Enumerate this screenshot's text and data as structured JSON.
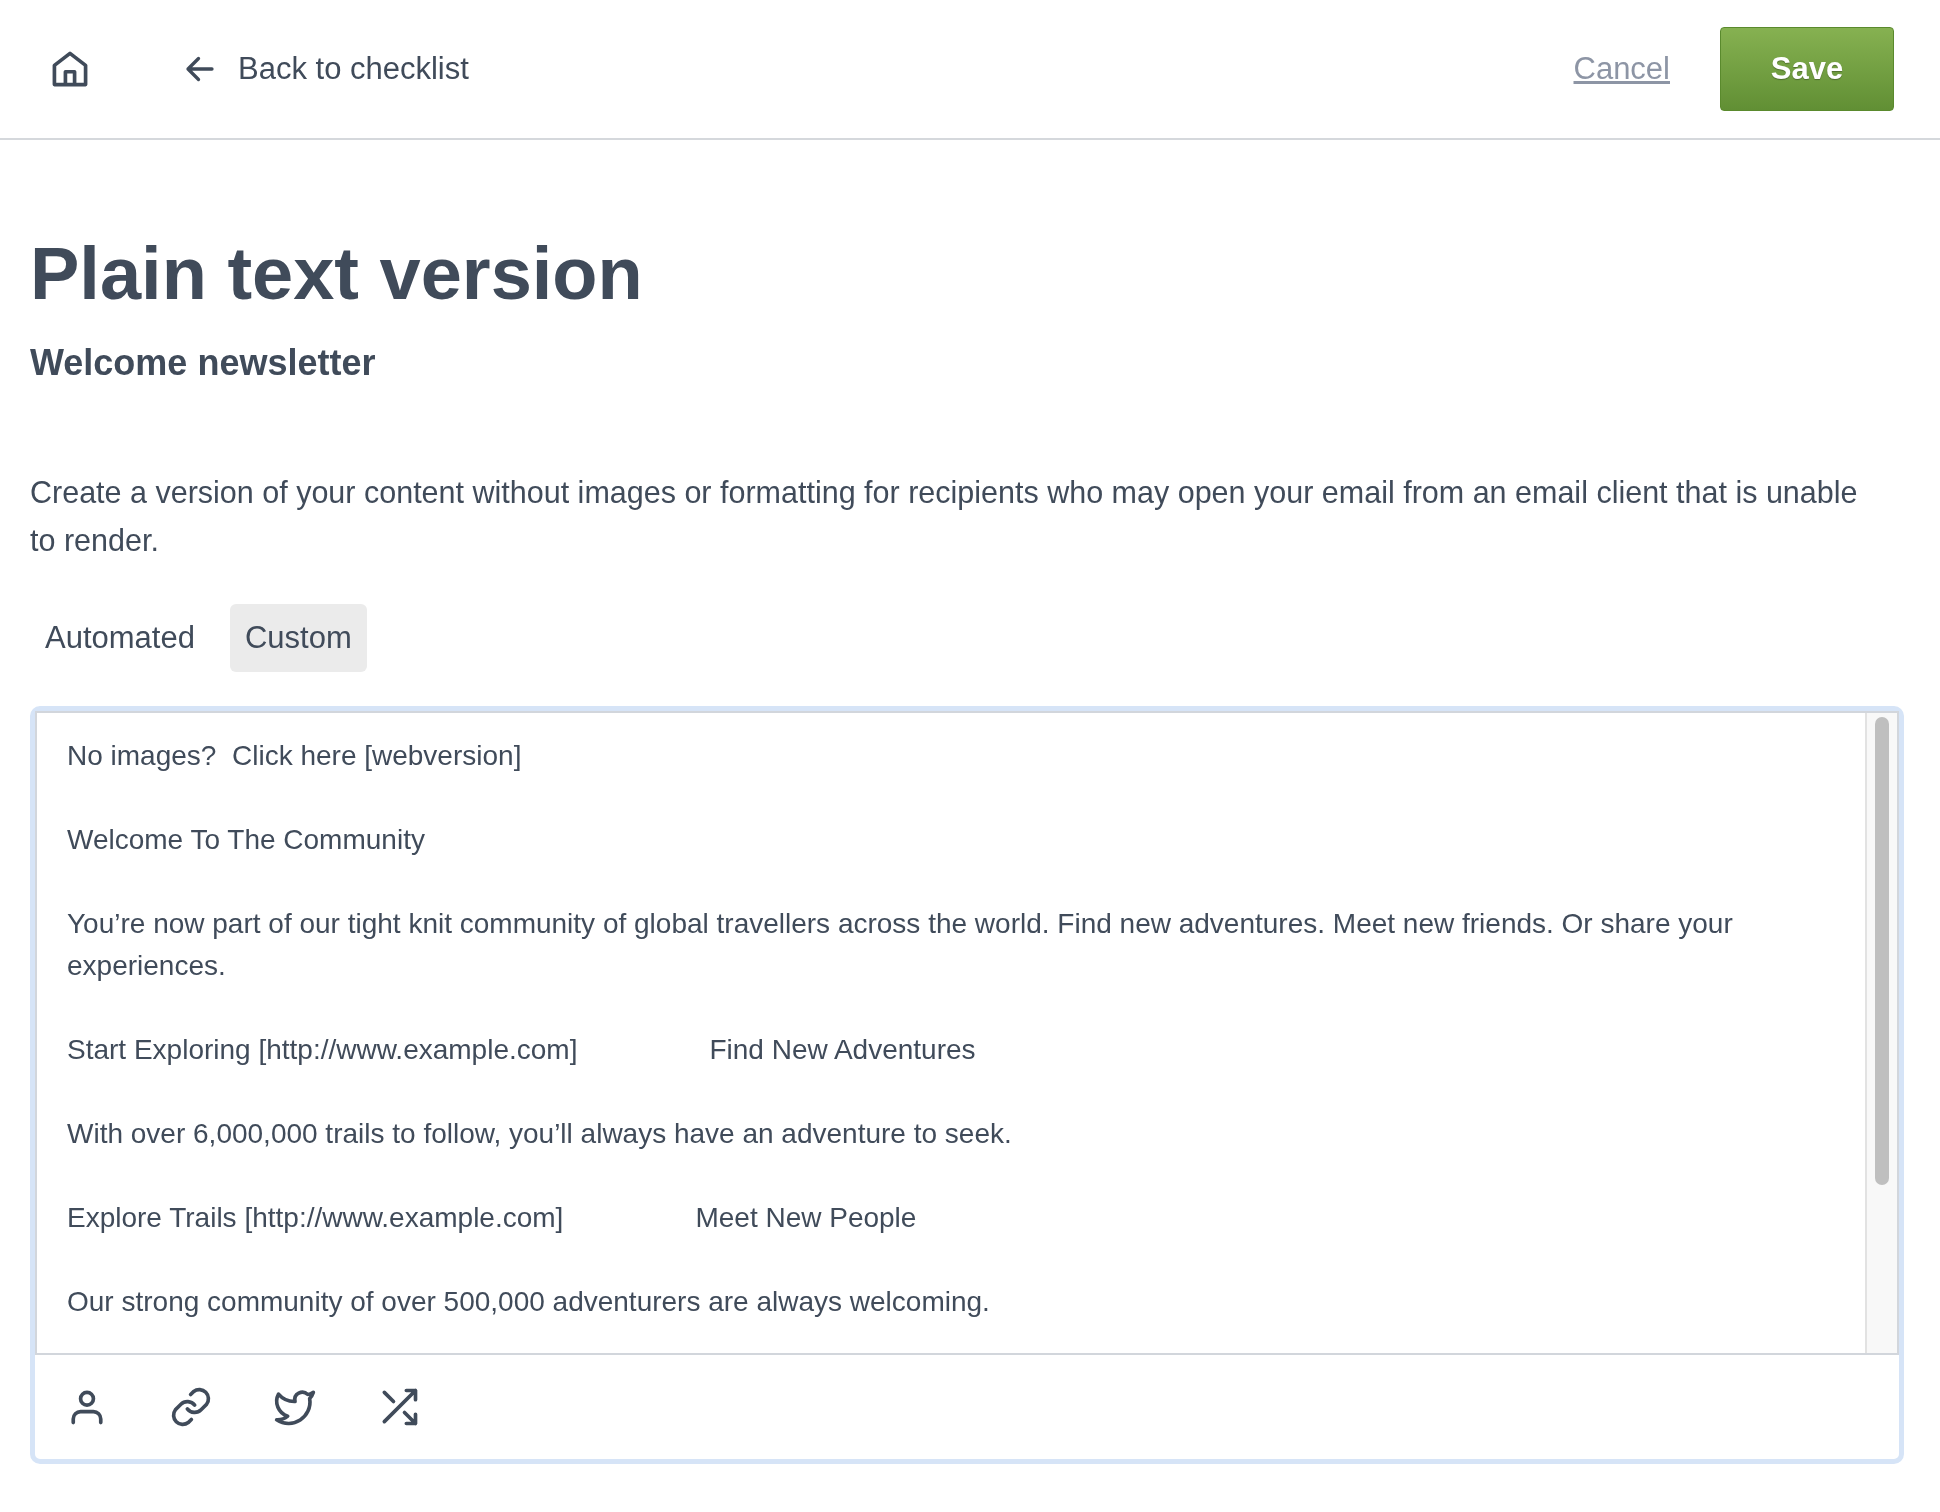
{
  "header": {
    "back_link": "Back to checklist",
    "cancel": "Cancel",
    "save": "Save"
  },
  "title": "Plain text version",
  "subtitle": "Welcome newsletter",
  "description": "Create a version of your content without images or formatting for recipients who may open your email from an email client that is unable to render.",
  "tabs": [
    {
      "label": "Automated",
      "selected": false
    },
    {
      "label": "Custom",
      "selected": true
    }
  ],
  "editor": {
    "paragraphs": [
      {
        "segments": [
          "No images?  Click here [webversion]"
        ]
      },
      {
        "segments": [
          "Welcome To The Community"
        ]
      },
      {
        "segments": [
          "You’re now part of our tight knit community of global travellers across the world. Find new adventures. Meet new friends. Or share your experiences."
        ]
      },
      {
        "segments": [
          "Start Exploring [http://www.example.com]",
          "Find New Adventures"
        ]
      },
      {
        "segments": [
          "With over 6,000,000 trails to follow, you’ll always have an adventure to seek."
        ]
      },
      {
        "segments": [
          "Explore Trails [http://www.example.com]",
          "Meet New People"
        ]
      },
      {
        "segments": [
          "Our strong community of over 500,000 adventurers are always welcoming."
        ]
      }
    ]
  }
}
